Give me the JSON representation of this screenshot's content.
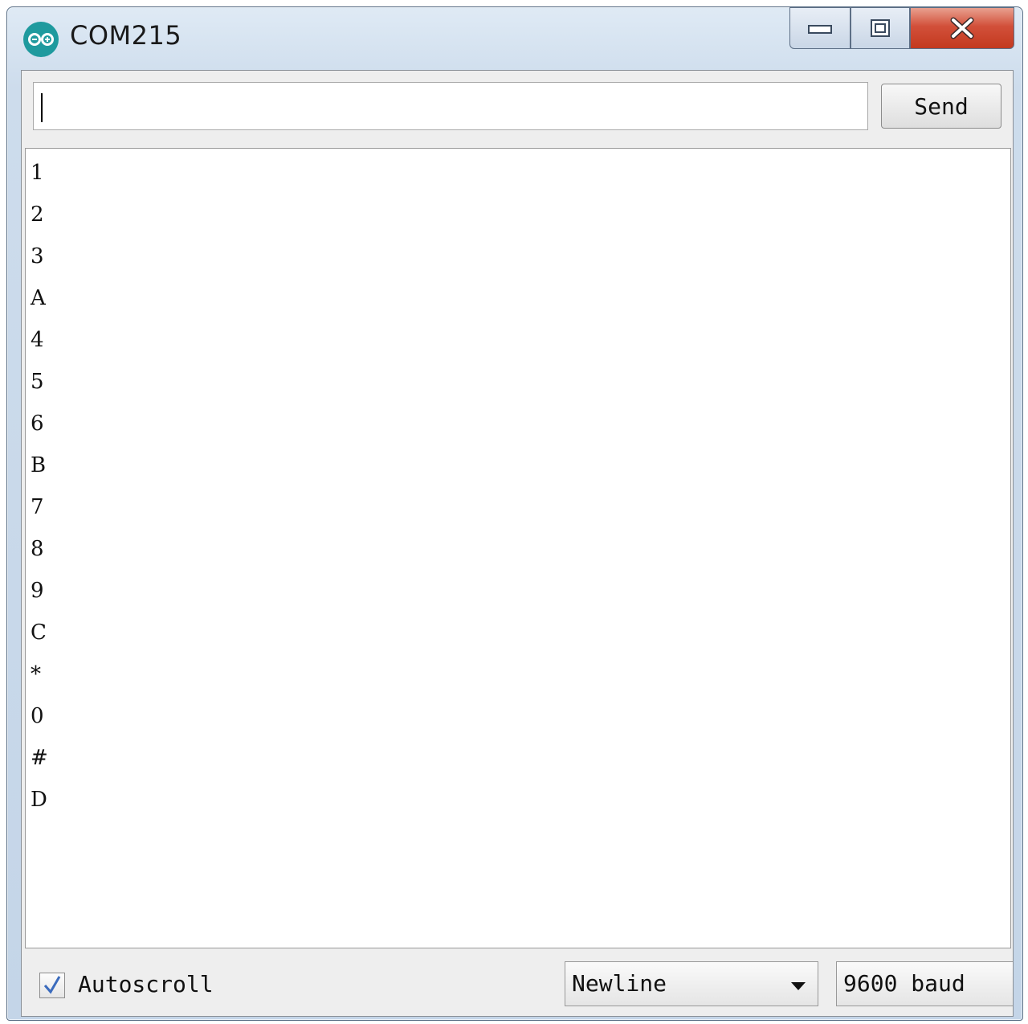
{
  "window": {
    "title": "COM215",
    "app_icon": "arduino-icon",
    "controls": [
      "minimize-icon",
      "maximize-icon",
      "close-icon"
    ]
  },
  "send_bar": {
    "input_value": "",
    "send_label": "Send"
  },
  "output_lines": [
    "1",
    "2",
    "3",
    "A",
    "4",
    "5",
    "6",
    "B",
    "7",
    "8",
    "9",
    "C",
    "*",
    "0",
    "#",
    "D"
  ],
  "footer": {
    "autoscroll_label": "Autoscroll",
    "autoscroll_checked": true,
    "line_ending": "Newline",
    "baud_rate": "9600 baud"
  },
  "colors": {
    "close_button": "#c3391f",
    "arduino_teal": "#1f9a9e"
  }
}
